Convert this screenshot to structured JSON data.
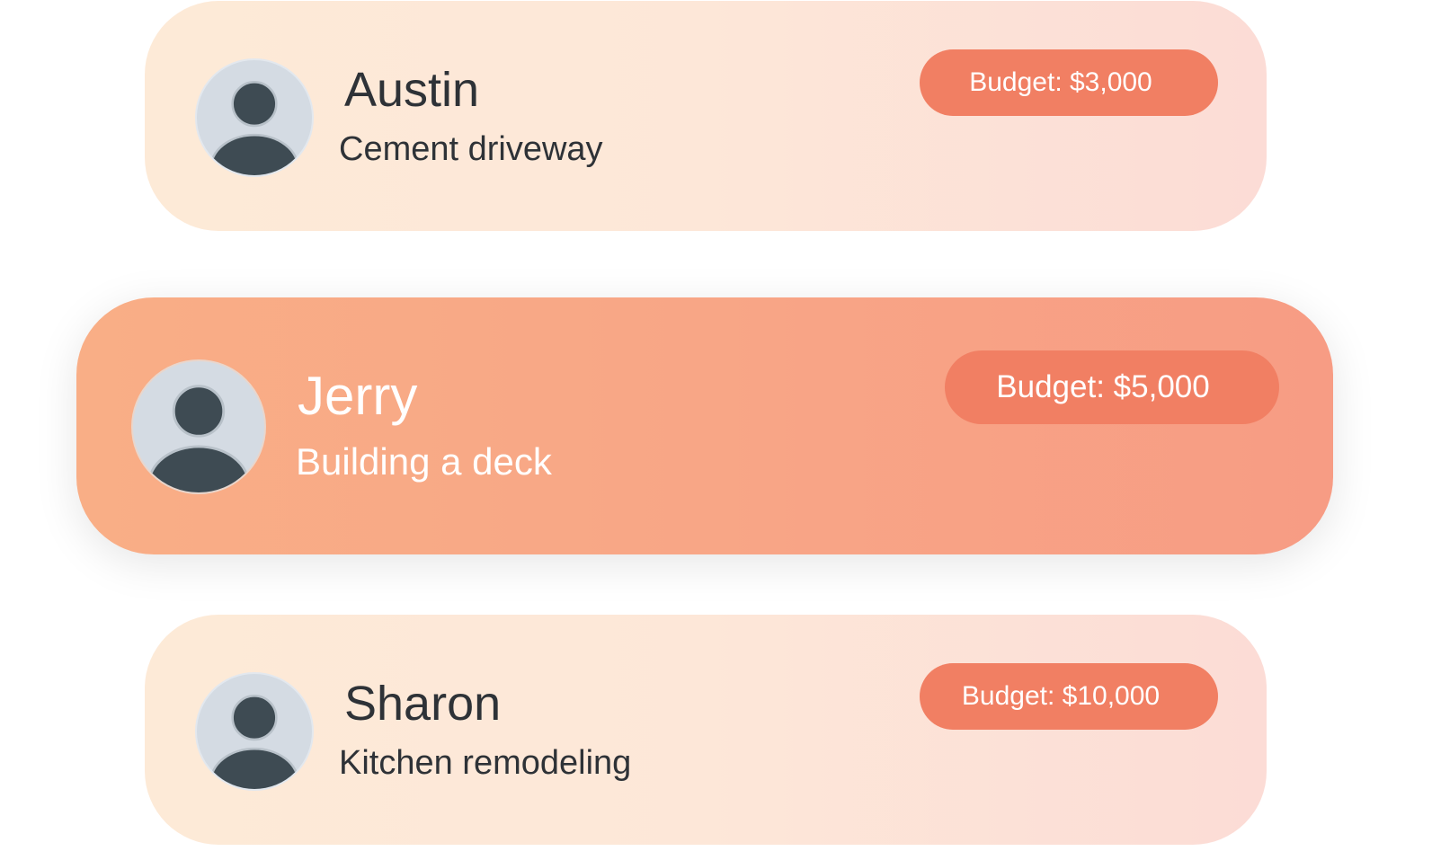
{
  "cards": [
    {
      "name": "Austin",
      "project": "Cement driveway",
      "budget_label": "Budget: $3,000",
      "highlighted": false
    },
    {
      "name": "Jerry",
      "project": "Building a deck",
      "budget_label": "Budget: $5,000",
      "highlighted": true
    },
    {
      "name": "Sharon",
      "project": "Kitchen remodeling",
      "budget_label": "Budget: $10,000",
      "highlighted": false
    }
  ],
  "icons": {
    "avatar": "user-avatar-icon"
  },
  "colors": {
    "badge": "#f17f63",
    "card_light_start": "#fdead7",
    "card_light_end": "#fcdcd6",
    "card_active_start": "#f9ae86",
    "card_active_end": "#f79c84",
    "avatar_bg": "#d4dbe3",
    "avatar_figure": "#3e4b53",
    "text_dark": "#2e3237",
    "text_light": "#ffffff"
  }
}
